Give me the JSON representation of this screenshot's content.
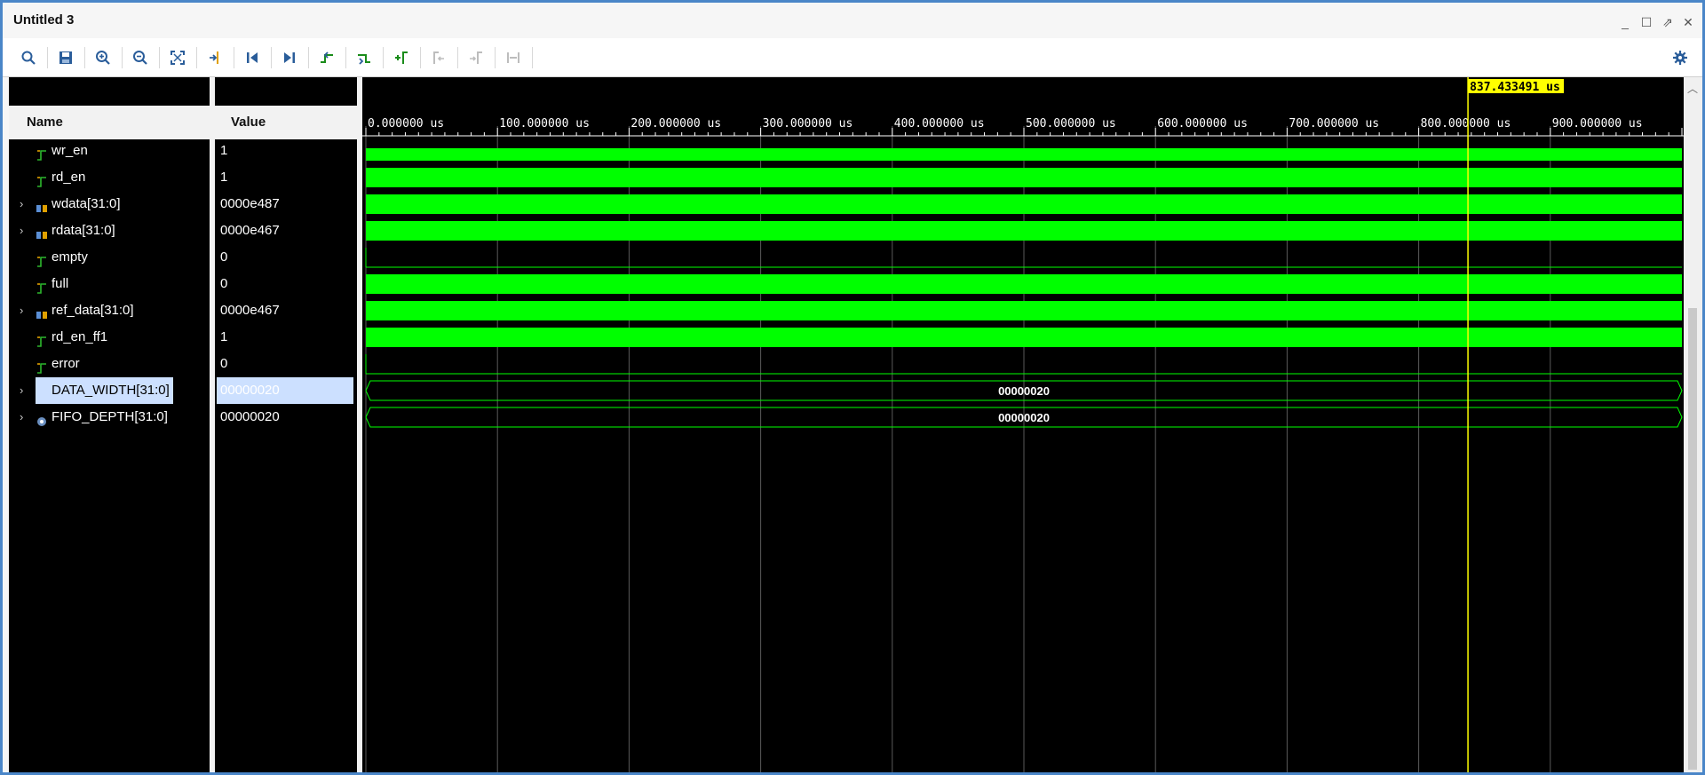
{
  "window": {
    "title": "Untitled 3"
  },
  "toolbar": {
    "buttons": [
      "search-icon",
      "save-icon",
      "zoom-in-icon",
      "zoom-out-icon",
      "zoom-fit-icon",
      "go-to-cursor-icon",
      "go-to-start-icon",
      "go-to-end-icon",
      "previous-transition-icon",
      "next-transition-icon",
      "add-marker-icon",
      "previous-marker-icon",
      "next-marker-icon",
      "swap-cursors-icon"
    ],
    "settings": "gear-icon"
  },
  "columns": {
    "name": "Name",
    "value": "Value"
  },
  "cursor": {
    "time_label": "837.433491 us",
    "time_us": 837.433491
  },
  "timeline": {
    "unit": "us",
    "ticks": [
      "0.000000 us",
      "100.000000 us",
      "200.000000 us",
      "300.000000 us",
      "400.000000 us",
      "500.000000 us",
      "600.000000 us",
      "700.000000 us",
      "800.000000 us",
      "900.000000 us"
    ],
    "range_us": [
      0,
      1000
    ]
  },
  "signals": [
    {
      "name": "wr_en",
      "value": "1",
      "type": "bit",
      "expandable": false,
      "wave": "toggle",
      "partial": true
    },
    {
      "name": "rd_en",
      "value": "1",
      "type": "bit",
      "expandable": false,
      "wave": "toggle"
    },
    {
      "name": "wdata[31:0]",
      "value": "0000e487",
      "type": "bus",
      "expandable": true,
      "wave": "toggle"
    },
    {
      "name": "rdata[31:0]",
      "value": "0000e467",
      "type": "bus",
      "expandable": true,
      "wave": "toggle"
    },
    {
      "name": "empty",
      "value": "0",
      "type": "bit",
      "expandable": false,
      "wave": "low"
    },
    {
      "name": "full",
      "value": "0",
      "type": "bit",
      "expandable": false,
      "wave": "toggle"
    },
    {
      "name": "ref_data[31:0]",
      "value": "0000e467",
      "type": "bus",
      "expandable": true,
      "wave": "toggle"
    },
    {
      "name": "rd_en_ff1",
      "value": "1",
      "type": "bit",
      "expandable": false,
      "wave": "toggle"
    },
    {
      "name": "error",
      "value": "0",
      "type": "bit",
      "expandable": false,
      "wave": "low"
    },
    {
      "name": "DATA_WIDTH[31:0]",
      "value": "00000020",
      "type": "param",
      "expandable": true,
      "wave": "const",
      "label": "00000020",
      "selected": true
    },
    {
      "name": "FIFO_DEPTH[31:0]",
      "value": "00000020",
      "type": "param",
      "expandable": true,
      "wave": "const",
      "label": "00000020"
    }
  ],
  "colors": {
    "wave": "#00ff00",
    "cursor": "#ffff00",
    "cursor_label_bg": "#ffff00",
    "grid": "#5a5a5a",
    "selection": "#cce0ff"
  }
}
